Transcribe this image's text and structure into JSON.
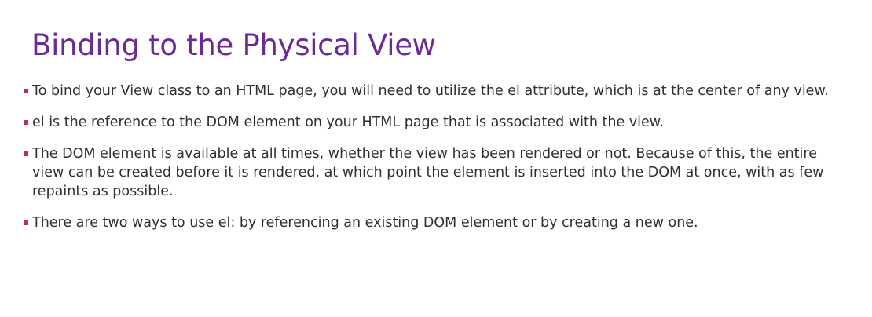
{
  "slide": {
    "title": "Binding to the Physical View",
    "accent_color": "#6b2b95",
    "bullet_color": "#c0304a",
    "bullets": [
      {
        "text": "To bind your View class to an HTML page, you will need to utilize the el attribute, which is at the center of any view."
      },
      {
        "text": "el is the reference to the DOM element on your HTML page that is associated with the view."
      },
      {
        "text": "The DOM element is available at all times, whether the view has been rendered or not. Because of this, the entire view can be created before it is rendered, at which point the element is inserted into the DOM at once, with as few repaints as possible."
      },
      {
        "text": "There are two ways to use el: by referencing an existing DOM element or by creating a new one."
      }
    ]
  }
}
